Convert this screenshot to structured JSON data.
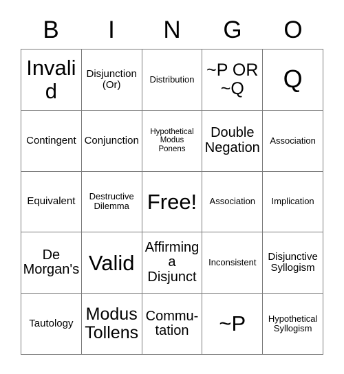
{
  "card": {
    "type": "bingo-card",
    "header_letters": [
      "B",
      "I",
      "N",
      "G",
      "O"
    ],
    "grid_size": "5x5",
    "free_space": "Free!",
    "rows": [
      [
        {
          "text": "Invalid",
          "size": "xl"
        },
        {
          "text": "Disjunction\n(Or)",
          "size": "sm"
        },
        {
          "text": "Distribution",
          "size": "xs"
        },
        {
          "text": "~P OR\n~Q",
          "size": "lg"
        },
        {
          "text": "Q",
          "size": "xxl"
        }
      ],
      [
        {
          "text": "Contingent",
          "size": "sm"
        },
        {
          "text": "Conjunction",
          "size": "sm"
        },
        {
          "text": "Hypothetical\nModus\nPonens",
          "size": "xxs"
        },
        {
          "text": "Double\nNegation",
          "size": "md"
        },
        {
          "text": "Association",
          "size": "xs"
        }
      ],
      [
        {
          "text": "Equivalent",
          "size": "sm"
        },
        {
          "text": "Destructive\nDilemma",
          "size": "xs"
        },
        {
          "text": "Free!",
          "size": "xl"
        },
        {
          "text": "Association",
          "size": "xs"
        },
        {
          "text": "Implication",
          "size": "xs"
        }
      ],
      [
        {
          "text": "De\nMorgan's",
          "size": "md"
        },
        {
          "text": "Valid",
          "size": "xl"
        },
        {
          "text": "Affirming\na\nDisjunct",
          "size": "md"
        },
        {
          "text": "Inconsistent",
          "size": "xs"
        },
        {
          "text": "Disjunctive\nSyllogism",
          "size": "sm"
        }
      ],
      [
        {
          "text": "Tautology",
          "size": "sm"
        },
        {
          "text": "Modus\nTollens",
          "size": "lg"
        },
        {
          "text": "Commu-\ntation",
          "size": "md"
        },
        {
          "text": "~P",
          "size": "xl"
        },
        {
          "text": "Hypothetical\nSyllogism",
          "size": "xs"
        }
      ]
    ]
  },
  "colors": {
    "background": "#ffffff",
    "text": "#000000",
    "grid_line": "#7a7a7a"
  }
}
